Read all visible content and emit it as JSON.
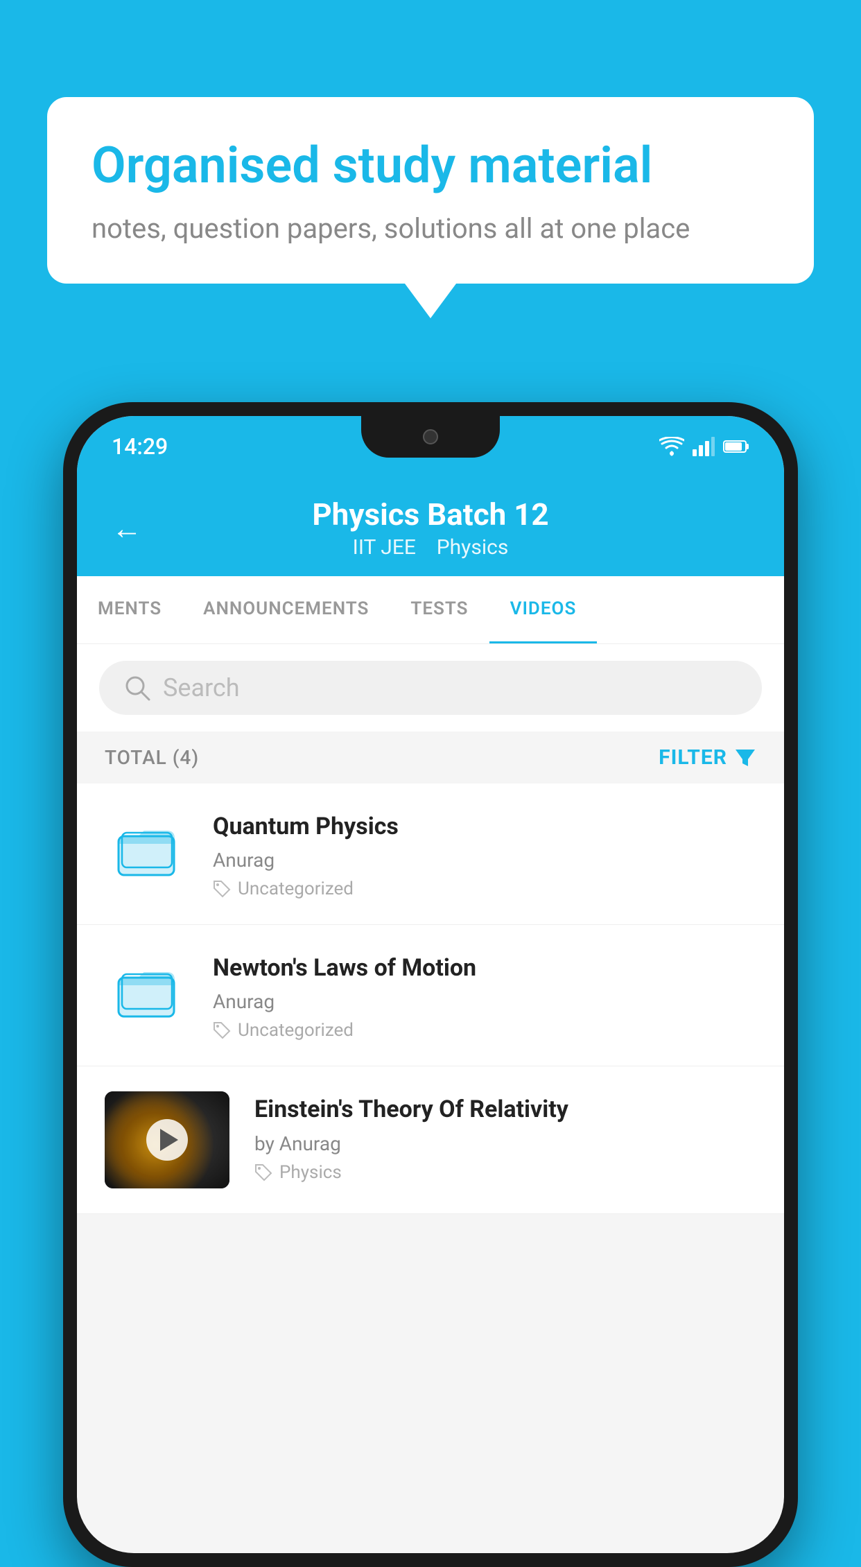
{
  "background_color": "#1ab8e8",
  "speech_bubble": {
    "title": "Organised study material",
    "subtitle": "notes, question papers, solutions all at one place"
  },
  "status_bar": {
    "time": "14:29",
    "wifi_icon": "wifi",
    "signal_icon": "signal",
    "battery_icon": "battery"
  },
  "app_header": {
    "back_label": "←",
    "title": "Physics Batch 12",
    "subtitle_parts": [
      "IIT JEE",
      "Physics"
    ]
  },
  "tabs": [
    {
      "label": "MENTS",
      "active": false
    },
    {
      "label": "ANNOUNCEMENTS",
      "active": false
    },
    {
      "label": "TESTS",
      "active": false
    },
    {
      "label": "VIDEOS",
      "active": true
    }
  ],
  "search": {
    "placeholder": "Search"
  },
  "filter_bar": {
    "total_label": "TOTAL (4)",
    "filter_label": "FILTER"
  },
  "videos": [
    {
      "id": 1,
      "title": "Quantum Physics",
      "author": "Anurag",
      "tag": "Uncategorized",
      "type": "folder",
      "has_thumbnail": false
    },
    {
      "id": 2,
      "title": "Newton's Laws of Motion",
      "author": "Anurag",
      "tag": "Uncategorized",
      "type": "folder",
      "has_thumbnail": false
    },
    {
      "id": 3,
      "title": "Einstein's Theory Of Relativity",
      "author": "by Anurag",
      "tag": "Physics",
      "type": "video",
      "has_thumbnail": true
    }
  ]
}
